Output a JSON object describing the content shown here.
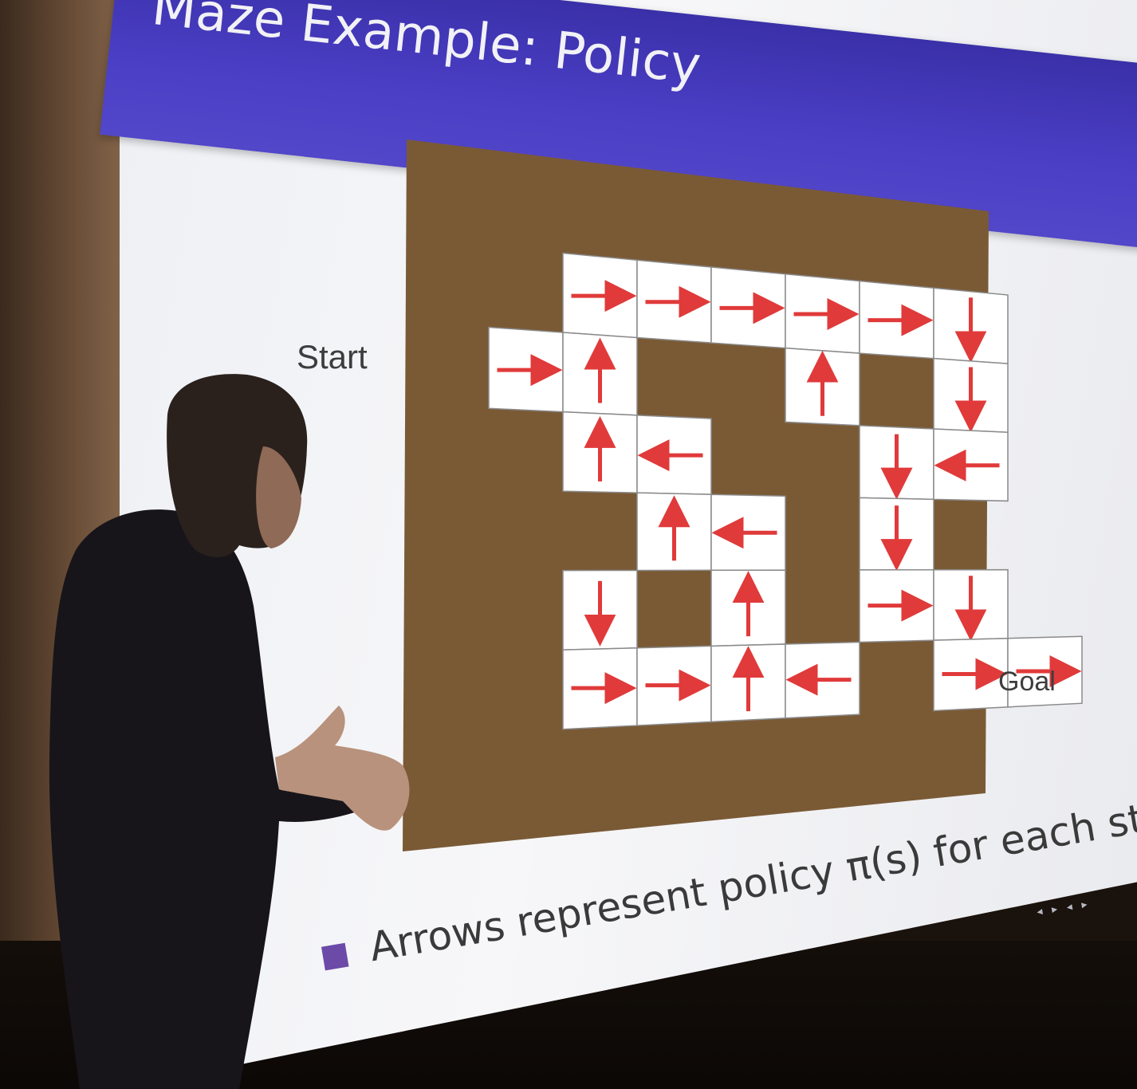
{
  "slide": {
    "title": "Maze Example: Policy",
    "start_label": "Start",
    "goal_label": "Goal",
    "bullet_text": "Arrows represent policy π(s) for each state s",
    "nav_icons": "◂ ▸ ◂ ▸"
  },
  "colors": {
    "maze_background": "#7a5a35",
    "cell": "#ffffff",
    "arrow": "#e03a3a",
    "title_bar": "#4b3fc6",
    "bullet": "#6c4aa8"
  },
  "maze": {
    "grid": "7 rows x 8 columns",
    "cells": [
      {
        "row": 0,
        "col": 2,
        "arrow": "right"
      },
      {
        "row": 0,
        "col": 3,
        "arrow": "right"
      },
      {
        "row": 0,
        "col": 4,
        "arrow": "right"
      },
      {
        "row": 0,
        "col": 5,
        "arrow": "right"
      },
      {
        "row": 0,
        "col": 6,
        "arrow": "right"
      },
      {
        "row": 0,
        "col": 7,
        "arrow": "down"
      },
      {
        "row": 1,
        "col": 1,
        "arrow": "right"
      },
      {
        "row": 1,
        "col": 2,
        "arrow": "up"
      },
      {
        "row": 1,
        "col": 5,
        "arrow": "up"
      },
      {
        "row": 1,
        "col": 7,
        "arrow": "down"
      },
      {
        "row": 2,
        "col": 2,
        "arrow": "up"
      },
      {
        "row": 2,
        "col": 3,
        "arrow": "left"
      },
      {
        "row": 2,
        "col": 6,
        "arrow": "down"
      },
      {
        "row": 2,
        "col": 7,
        "arrow": "left"
      },
      {
        "row": 3,
        "col": 3,
        "arrow": "up"
      },
      {
        "row": 3,
        "col": 4,
        "arrow": "left"
      },
      {
        "row": 3,
        "col": 6,
        "arrow": "down"
      },
      {
        "row": 4,
        "col": 2,
        "arrow": "down"
      },
      {
        "row": 4,
        "col": 4,
        "arrow": "up"
      },
      {
        "row": 4,
        "col": 6,
        "arrow": "right"
      },
      {
        "row": 4,
        "col": 7,
        "arrow": "down"
      },
      {
        "row": 5,
        "col": 2,
        "arrow": "right"
      },
      {
        "row": 5,
        "col": 3,
        "arrow": "right"
      },
      {
        "row": 5,
        "col": 4,
        "arrow": "up"
      },
      {
        "row": 5,
        "col": 5,
        "arrow": "left"
      },
      {
        "row": 5,
        "col": 7,
        "arrow": "right"
      },
      {
        "row": 5,
        "col": 8,
        "arrow": "right"
      }
    ]
  }
}
